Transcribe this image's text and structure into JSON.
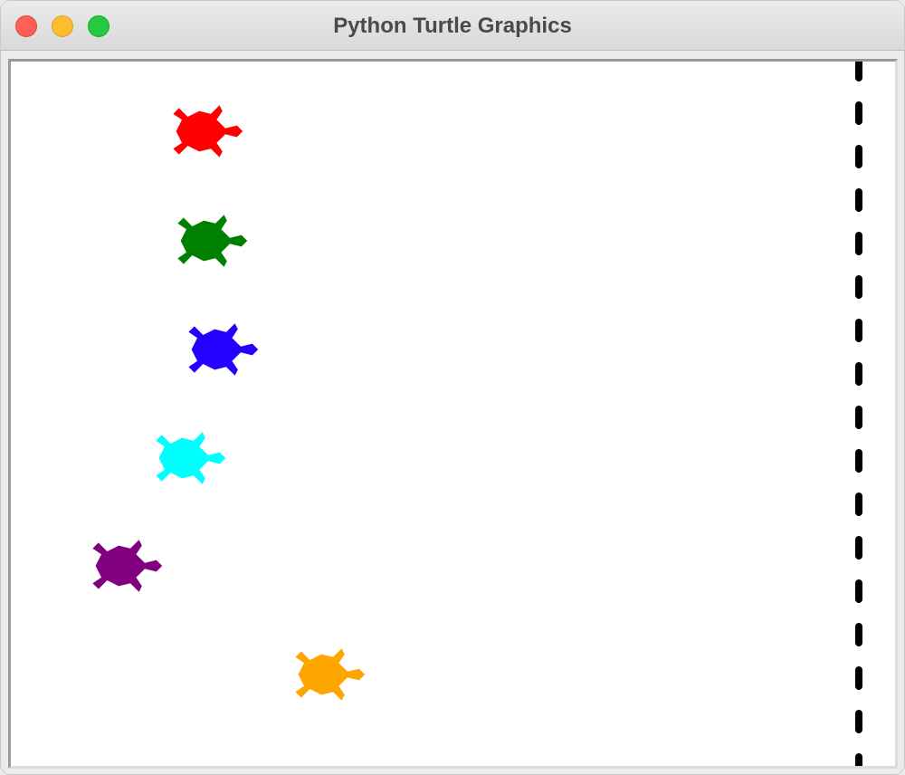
{
  "window": {
    "title": "Python Turtle Graphics",
    "controls": {
      "close": {
        "icon": "close-icon",
        "color": "#fe5f57"
      },
      "minimize": {
        "icon": "minimize-icon",
        "color": "#febc2e"
      },
      "zoom": {
        "icon": "zoom-icon",
        "color": "#28c840"
      }
    }
  },
  "canvas": {
    "background": "#ffffff",
    "finish_line": {
      "color": "#000000",
      "style": "dashed"
    },
    "turtles": [
      {
        "name": "turtle-red",
        "color": "#ff0000",
        "heading": "right"
      },
      {
        "name": "turtle-green",
        "color": "#008000",
        "heading": "right"
      },
      {
        "name": "turtle-blue",
        "color": "#2400ff",
        "heading": "right"
      },
      {
        "name": "turtle-cyan",
        "color": "#00ffff",
        "heading": "right"
      },
      {
        "name": "turtle-purple",
        "color": "#800080",
        "heading": "right"
      },
      {
        "name": "turtle-orange",
        "color": "#ffa500",
        "heading": "right"
      }
    ]
  }
}
